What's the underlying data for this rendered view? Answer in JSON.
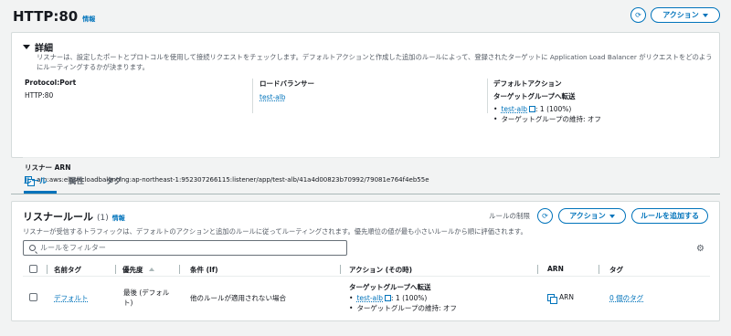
{
  "header": {
    "title": "HTTP:80",
    "info": "情報",
    "actions_label": "アクション"
  },
  "details": {
    "title": "詳細",
    "description": "リスナーは、設定したポートとプロトコルを使用して接続リクエストをチェックします。デフォルトアクションと作成した追加のルールによって、登録されたターゲットに Application Load Balancer がリクエストをどのようにルーティングするかが決まります。",
    "protocol_label": "Protocol:Port",
    "protocol_value": "HTTP:80",
    "lb_label": "ロードバランサー",
    "lb_value": "test-alb",
    "default_action_label": "デフォルトアクション",
    "forward_label": "ターゲットグループへ転送",
    "target_link": "test-alb",
    "target_weight": ": 1 (100%)",
    "stickiness": "ターゲットグループの維持: オフ",
    "arn_label": "リスナー ARN",
    "arn_value": "arn:aws:elasticloadbalancing:ap-northeast-1:952307266115:listener/app/test-alb/41a4d00823b70992/79081e764f4eb55e"
  },
  "tabs": [
    {
      "label": "ルール"
    },
    {
      "label": "属性"
    },
    {
      "label": "タグ"
    }
  ],
  "rules": {
    "title": "リスナールール",
    "count": "(1)",
    "info": "情報",
    "description": "リスナーが受信するトラフィックは、デフォルトのアクションと追加のルールに従ってルーティングされます。優先順位の値が最も小さいルールから順に評価されます。",
    "limit_label": "ルールの制限",
    "actions_label": "アクション",
    "add_rule_label": "ルールを追加する",
    "filter_placeholder": "ルールをフィルター",
    "columns": [
      "名前タグ",
      "優先度",
      "条件 (If)",
      "アクション (その時)",
      "ARN",
      "タグ"
    ],
    "rows": [
      {
        "name": "デフォルト",
        "priority": "最後 (デフォルト)",
        "condition": "他のルールが適用されない場合",
        "action_title": "ターゲットグループへ転送",
        "action_target": "test-alb",
        "action_weight": ": 1 (100%)",
        "action_stickiness": "ターゲットグループの維持: オフ",
        "arn": "ARN",
        "tags": "0 個のタグ"
      }
    ]
  }
}
